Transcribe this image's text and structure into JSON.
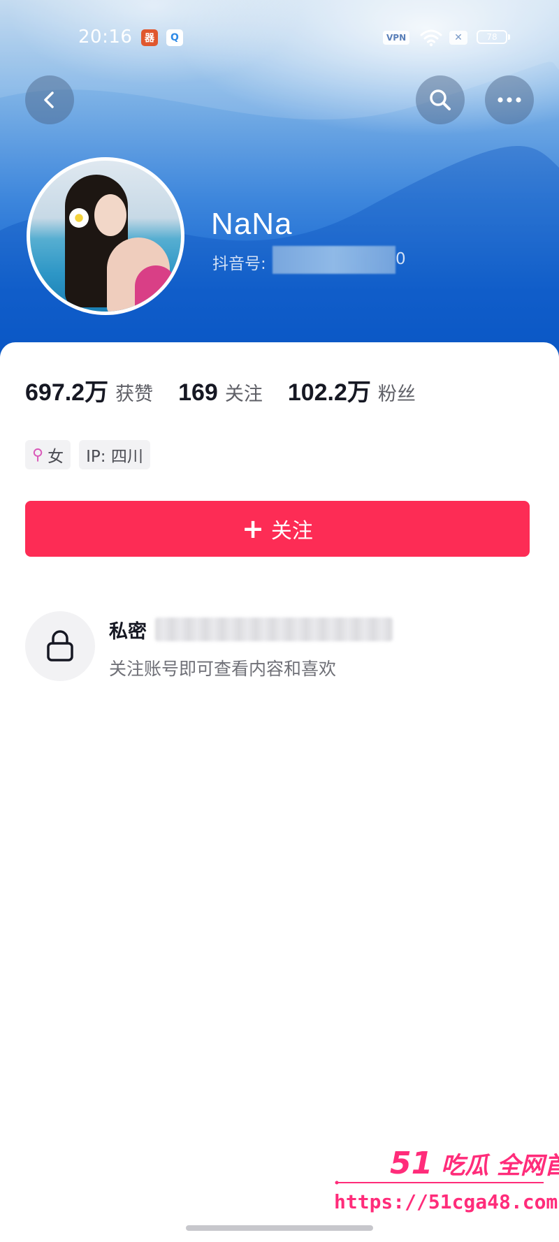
{
  "status_bar": {
    "time": "20:16",
    "app_icon_1": "器",
    "app_icon_2": "Q",
    "vpn": "VPN",
    "x_badge": "✕",
    "battery": "78"
  },
  "nav": {
    "back_icon": "chevron-left-icon",
    "search_icon": "search-icon",
    "more_icon": "more-horizontal-icon"
  },
  "profile": {
    "name": "NaNa",
    "id_label": "抖音号:",
    "id_tail": "0"
  },
  "stats": [
    {
      "value": "697.2万",
      "label": "获赞"
    },
    {
      "value": "169",
      "label": "关注"
    },
    {
      "value": "102.2万",
      "label": "粉丝"
    }
  ],
  "tags": {
    "gender_symbol": "⚲",
    "gender": "女",
    "ip": "IP:  四川"
  },
  "follow_button": {
    "plus": "+",
    "label": "关注"
  },
  "private_notice": {
    "title": "私密",
    "description": "关注账号即可查看内容和喜欢"
  },
  "watermark": {
    "brand_number": "51",
    "brand_text": "吃瓜 全网首发",
    "url": "https://51cga48.com"
  },
  "colors": {
    "follow_red": "#fd2c55",
    "watermark_pink": "#ff2c7a",
    "header_blue": "#1565d0"
  }
}
